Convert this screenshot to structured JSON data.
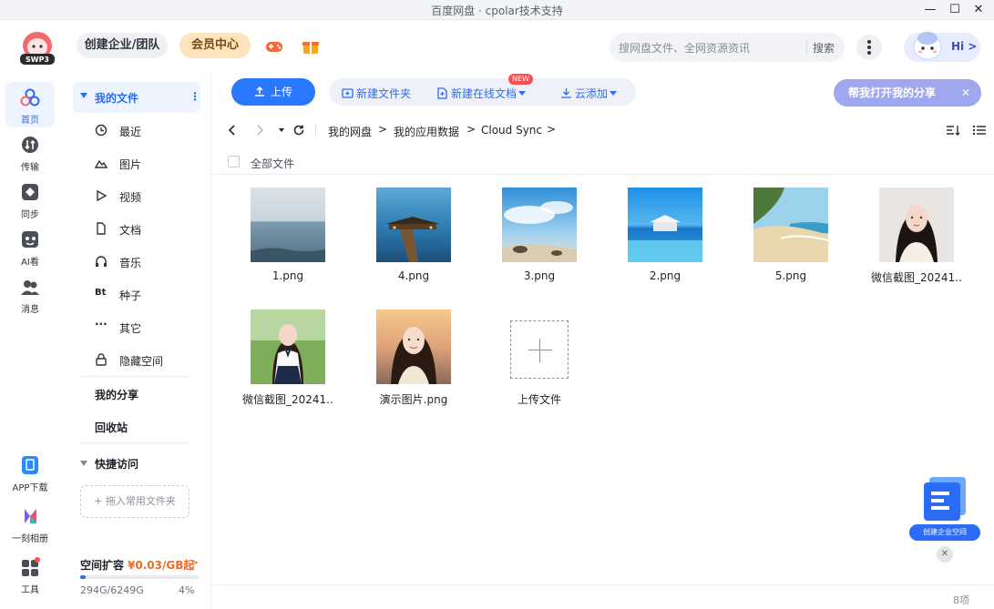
{
  "window": {
    "title": "百度网盘 · cpolar技术支持",
    "minimize": "—",
    "maximize": "☐",
    "close": "✕"
  },
  "header": {
    "logo_text": "SWP3",
    "enterprise_label": "创建企业/团队",
    "vip_label": "会员中心",
    "search_placeholder": "搜网盘文件、全网资源资讯",
    "search_button": "搜索",
    "hi_label": "Hi >"
  },
  "rail": {
    "items": [
      {
        "label": "首页",
        "icon": "home-icon"
      },
      {
        "label": "传输",
        "icon": "transfer-icon"
      },
      {
        "label": "同步",
        "icon": "sync-icon"
      },
      {
        "label": "AI看",
        "icon": "ai-icon"
      },
      {
        "label": "消息",
        "icon": "message-icon"
      }
    ],
    "bottom": [
      {
        "label": "APP下载",
        "icon": "phone-icon"
      },
      {
        "label": "一刻相册",
        "icon": "album-icon"
      },
      {
        "label": "工具",
        "icon": "tools-icon"
      }
    ]
  },
  "sidebar": {
    "my_files": "我的文件",
    "more": "⋮",
    "items": [
      {
        "label": "最近",
        "icon": "clock-icon"
      },
      {
        "label": "图片",
        "icon": "image-icon"
      },
      {
        "label": "视频",
        "icon": "play-icon"
      },
      {
        "label": "文档",
        "icon": "doc-icon"
      },
      {
        "label": "音乐",
        "icon": "headphone-icon"
      },
      {
        "label": "种子",
        "icon": "bt-icon"
      },
      {
        "label": "其它",
        "icon": "more-dots-icon"
      },
      {
        "label": "隐藏空间",
        "icon": "lock-icon"
      }
    ],
    "bt_glyph": "Bt",
    "other_glyph": "···",
    "my_share": "我的分享",
    "recycle": "回收站",
    "quick_access": "快捷访问",
    "drop_hint": "+ 拖入常用文件夹",
    "expand_title": "空间扩容",
    "expand_price": "¥0.03/GB起",
    "expand_arrow": ">",
    "quota_text": "294G/6249G",
    "quota_pct": "4%",
    "quota_fraction": 0.047
  },
  "toolbar": {
    "upload": "上传",
    "new_folder": "新建文件夹",
    "new_doc": "新建在线文档",
    "new_badge": "NEW",
    "cloud_add": "云添加",
    "share_prompt": "帮我打开我的分享",
    "share_close": "✕"
  },
  "breadcrumb": {
    "items": [
      "我的网盘",
      "我的应用数据",
      "Cloud Sync"
    ],
    "sep": ">"
  },
  "list": {
    "select_all": "全部文件",
    "files": [
      {
        "name": "1.png",
        "thumb": "sea-calm"
      },
      {
        "name": "4.png",
        "thumb": "pier-dusk"
      },
      {
        "name": "3.png",
        "thumb": "beach-sky"
      },
      {
        "name": "2.png",
        "thumb": "infinity-pool"
      },
      {
        "name": "5.png",
        "thumb": "sandy-coast"
      },
      {
        "name": "微信截图_20241...",
        "thumb": "portrait-1"
      },
      {
        "name": "微信截图_20241...",
        "thumb": "portrait-2"
      },
      {
        "name": "演示图片.png",
        "thumb": "portrait-3"
      }
    ],
    "upload_tile": "上传文件",
    "count": "8项"
  },
  "promo": {
    "label": "创建企业空间",
    "close": "✕"
  },
  "colors": {
    "accent": "#2a6cf6",
    "upload": "#2a78ff",
    "vip": "#fde4bd",
    "price": "#f06a22"
  }
}
